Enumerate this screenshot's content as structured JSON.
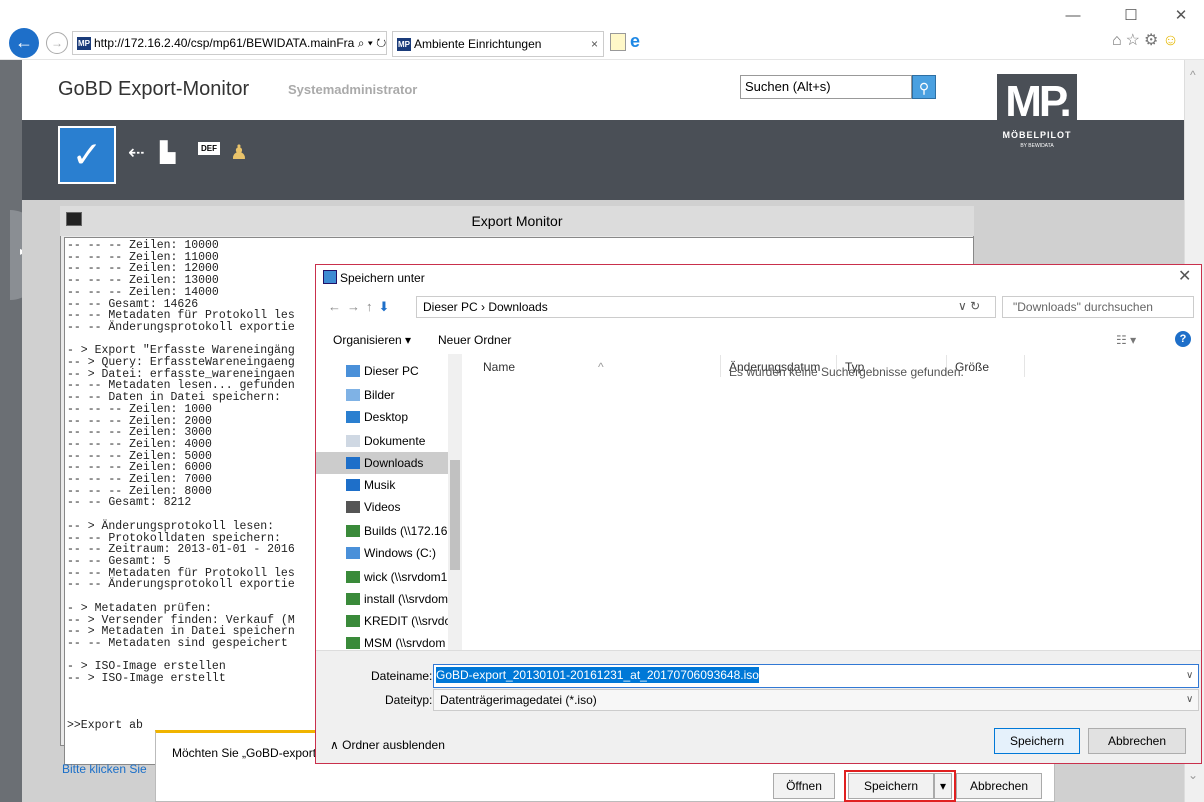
{
  "browser": {
    "url": "http://172.16.2.40/csp/mp61/BEWIDATA.mainFra",
    "tab_title": "Ambiente Einrichtungen",
    "favicon_text": "MP"
  },
  "app": {
    "title": "GoBD Export-Monitor",
    "user": "Systemadministrator",
    "search_placeholder": "Suchen (Alt+s)",
    "logo_big": "MP.",
    "logo_name": "MÖBELPILOT",
    "logo_sub": "BY BEWIDATA",
    "toolbar_def": "DEF"
  },
  "export_monitor": {
    "title": "Export Monitor",
    "lines": [
      "-- -- -- Zeilen: 10000",
      "-- -- -- Zeilen: 11000",
      "-- -- -- Zeilen: 12000",
      "-- -- -- Zeilen: 13000",
      "-- -- -- Zeilen: 14000",
      "-- -- Gesamt: 14626",
      "-- -- Metadaten für Protokoll les",
      "-- -- Änderungsprotokoll exportie",
      "",
      "- > Export \"Erfasste Wareneingäng",
      "-- > Query: ErfassteWareneingaeng",
      "-- > Datei: erfasste_wareneingaen",
      "-- -- Metadaten lesen... gefunden",
      "-- -- Daten in Datei speichern:",
      "-- -- -- Zeilen: 1000",
      "-- -- -- Zeilen: 2000",
      "-- -- -- Zeilen: 3000",
      "-- -- -- Zeilen: 4000",
      "-- -- -- Zeilen: 5000",
      "-- -- -- Zeilen: 6000",
      "-- -- -- Zeilen: 7000",
      "-- -- -- Zeilen: 8000",
      "-- -- Gesamt: 8212",
      "",
      "-- > Änderungsprotokoll lesen:",
      "-- -- Protokolldaten speichern:",
      "-- -- Zeitraum: 2013-01-01 - 2016",
      "-- -- Gesamt: 5",
      "-- -- Metadaten für Protokoll les",
      "-- -- Änderungsprotokoll exportie",
      "",
      "- > Metadaten prüfen:",
      "-- > Versender finden: Verkauf (M",
      "-- > Metadaten in Datei speichern",
      "-- -- Metadaten sind gespeichert",
      "",
      "- > ISO-Image erstellen",
      "-- > ISO-Image erstellt",
      "",
      "",
      "",
      ">>Export ab"
    ],
    "link": "Bitte klicken Sie"
  },
  "notification": {
    "prompt": "Möchten Sie „GoBD-export_",
    "open": "Öffnen",
    "save": "Speichern",
    "cancel": "Abbrechen"
  },
  "dialog": {
    "title": "Speichern unter",
    "path": "Dieser PC  ›  Downloads",
    "search_placeholder": "\"Downloads\" durchsuchen",
    "organize": "Organisieren ▾",
    "new_folder": "Neuer Ordner",
    "tree": [
      "Dieser PC",
      "Bilder",
      "Desktop",
      "Dokumente",
      "Downloads",
      "Musik",
      "Videos",
      "Builds (\\\\172.16.",
      "Windows (C:)",
      "wick (\\\\srvdom1",
      "install (\\\\srvdom",
      "KREDIT (\\\\srvdoi",
      "MSM (\\\\srvdom"
    ],
    "columns": [
      "Name",
      "Änderungsdatum",
      "Typ",
      "Größe"
    ],
    "empty_message": "Es wurden keine Suchergebnisse gefunden.",
    "filename_label": "Dateiname:",
    "filename": "GoBD-export_20130101-20161231_at_20170706093648.iso",
    "filetype_label": "Dateityp:",
    "filetype": "Datenträgerimagedatei (*.iso)",
    "hide_folders": "Ordner ausblenden",
    "save": "Speichern",
    "cancel": "Abbrechen"
  }
}
